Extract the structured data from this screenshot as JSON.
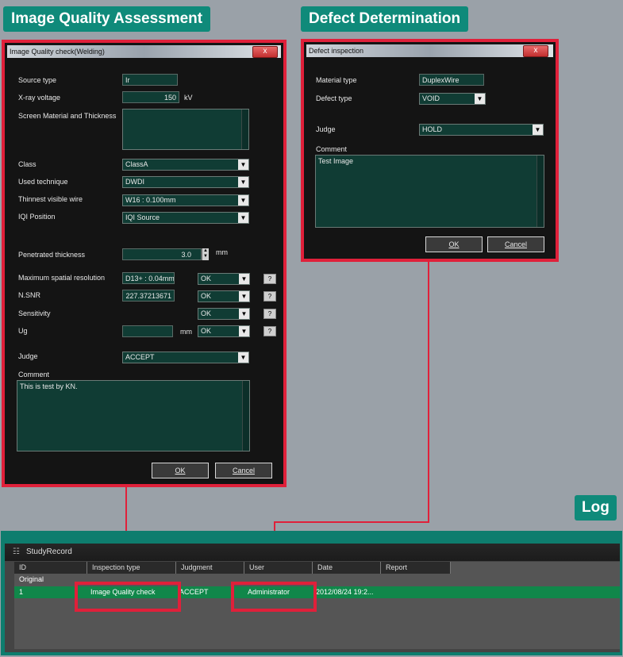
{
  "tags": {
    "iqa": "Image Quality Assessment",
    "defect": "Defect Determination",
    "log": "Log"
  },
  "iq_dialog": {
    "title": "Image Quality check(Welding)",
    "close": "x",
    "source_type_label": "Source type",
    "source_type_value": "Ir",
    "xray_voltage_label": "X-ray voltage",
    "xray_voltage_value": "150",
    "xray_voltage_unit": "kV",
    "screen_label": "Screen Material and Thickness",
    "class_label": "Class",
    "class_value": "ClassA",
    "technique_label": "Used technique",
    "technique_value": "DWDI",
    "wire_label": "Thinnest visible wire",
    "wire_value": "W16 : 0.100mm",
    "iqi_label": "IQI Position",
    "iqi_value": "IQI Source",
    "penetrated_label": "Penetrated thickness",
    "penetrated_value": "3.0",
    "penetrated_unit": "mm",
    "max_res_label": "Maximum spatial resolution",
    "max_res_value": "D13+ : 0.04mm",
    "max_res_status": "OK",
    "nsnr_label": "N.SNR",
    "nsnr_value": "227.37213671",
    "nsnr_status": "OK",
    "sensitivity_label": "Sensitivity",
    "sensitivity_status": "OK",
    "ug_label": "Ug",
    "ug_unit": "mm",
    "ug_status": "OK",
    "help": "?",
    "judge_label": "Judge",
    "judge_value": "ACCEPT",
    "comment_label": "Comment",
    "comment_value": "This is test by KN.",
    "ok": "OK",
    "cancel": "Cancel"
  },
  "defect_dialog": {
    "title": "Defect inspection",
    "close": "x",
    "material_label": "Material type",
    "material_value": "DuplexWire",
    "defect_type_label": "Defect type",
    "defect_type_value": "VOID",
    "judge_label": "Judge",
    "judge_value": "HOLD",
    "comment_label": "Comment",
    "comment_value": "Test Image",
    "ok": "OK",
    "cancel": "Cancel"
  },
  "log": {
    "title": "StudyRecord",
    "columns": [
      "ID",
      "Inspection type",
      "Judgment",
      "User",
      "Date",
      "Report"
    ],
    "original_label": "Original",
    "row": {
      "id": "1",
      "inspection_type": "Image Quality check",
      "judgment": "ACCEPT",
      "user": "Administrator",
      "date": "2012/08/24 19:2...",
      "report": ""
    }
  },
  "colors": {
    "accent": "#0f8a7a",
    "highlight": "#e0203a",
    "dialog_bg": "#141414",
    "field_bg": "#103c34",
    "selected_row": "#10874a"
  }
}
